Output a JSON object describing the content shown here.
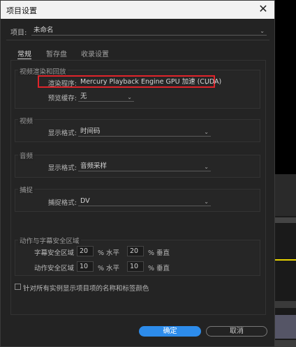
{
  "dialog": {
    "title": "项目设置",
    "close_glyph": "✕",
    "project_label": "项目:",
    "project_name": "未命名",
    "tabs": [
      {
        "label": "常规",
        "active": true
      },
      {
        "label": "暂存盘",
        "active": false
      },
      {
        "label": "收录设置",
        "active": false
      }
    ],
    "render": {
      "group_label": "视频渲染和回放",
      "renderer_label": "渲染程序:",
      "renderer_value": "Mercury Playback Engine GPU 加速 (CUDA)",
      "preview_cache_label": "预览缓存:",
      "preview_cache_value": "无"
    },
    "video": {
      "group_label": "视频",
      "format_label": "显示格式:",
      "format_value": "时间码"
    },
    "audio": {
      "group_label": "音频",
      "format_label": "显示格式:",
      "format_value": "音频采样"
    },
    "capture": {
      "group_label": "捕捉",
      "format_label": "捕捉格式:",
      "format_value": "DV"
    },
    "safe_area": {
      "group_label": "动作与字幕安全区域",
      "title_label": "字幕安全区域",
      "title_h": "20",
      "title_v": "20",
      "action_label": "动作安全区域",
      "action_h": "10",
      "action_v": "10",
      "h_unit": "% 水平",
      "v_unit": "% 垂直"
    },
    "show_names_label": "针对所有实例显示项目项的名称和标签颜色",
    "ok_label": "确定",
    "cancel_label": "取消"
  },
  "colors": {
    "highlight_box": "#e0242b",
    "ok_button": "#2d8ceb",
    "timeline_yellow": "#e8d400"
  }
}
